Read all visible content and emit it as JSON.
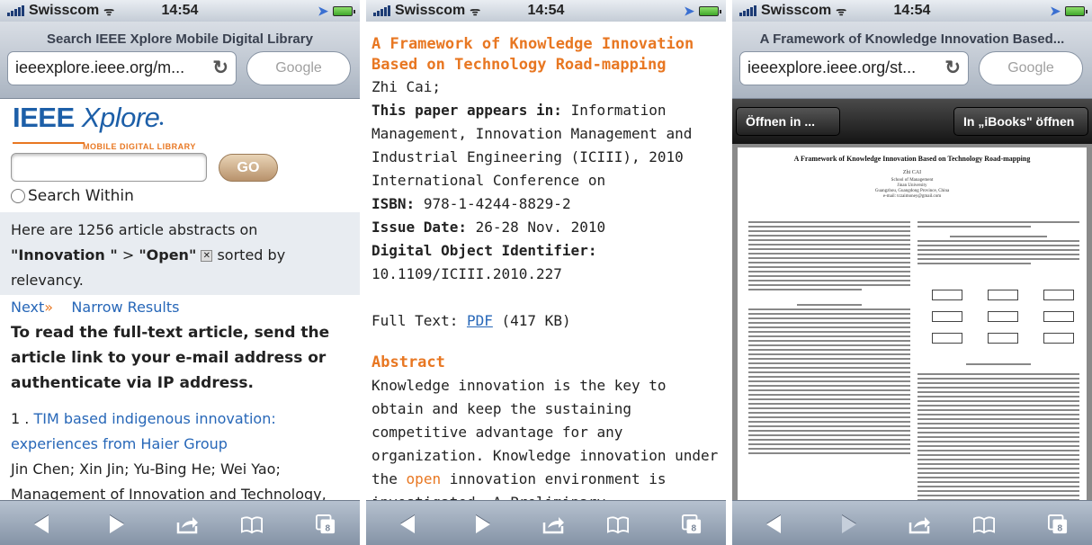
{
  "status_bar": {
    "carrier": "Swisscom",
    "time": "14:54"
  },
  "screens": [
    {
      "page_title": "Search IEEE Xplore Mobile Digital Library",
      "url": "ieeexplore.ieee.org/m...",
      "search_placeholder": "Google",
      "logo_text": "IEEE",
      "logo_text2": "Xplore",
      "logo_sub": "MOBILE DIGITAL LIBRARY",
      "go_label": "GO",
      "search_within": "Search Within",
      "info": {
        "prefix": "Here are 1256 article abstracts on",
        "term1": "\"Innovation \"",
        "sep": ">",
        "term2": "\"Open\"",
        "suffix": "sorted by relevancy."
      },
      "next_label": "Next",
      "narrow_label": "Narrow Results",
      "note": "To read the full-text article, send the article link to your e-mail address or authenticate via IP address.",
      "result": {
        "number": "1 .",
        "title": "TIM based indigenous innovation: experiences from Haier Group",
        "authors": "Jin Chen; Xin Jin; Yu-Bing He; Wei Yao;",
        "source": "Management of Innovation and Technology,"
      }
    },
    {
      "title": "A Framework of Knowledge Innovation Based on Technology Road-mapping",
      "author": "Zhi Cai;",
      "appears_label": "This paper appears in:",
      "appears_value": "Information Management, Innovation Management and Industrial Engineering (ICIII), 2010 International Conference on",
      "isbn_label": "ISBN:",
      "isbn_value": "978-1-4244-8829-2",
      "issue_label": "Issue Date:",
      "issue_value": "26-28 Nov. 2010",
      "doi_label": "Digital Object Identifier:",
      "doi_value": "10.1109/ICIII.2010.227",
      "fulltext_label": "Full Text:",
      "pdf_link": "PDF",
      "pdf_size": "(417 KB)",
      "abstract_heading": "Abstract",
      "abstract_a": "Knowledge innovation is the key to obtain and keep the sustaining competitive advantage for any organization. Knowledge innovation under the",
      "abstract_hl": "open",
      "abstract_b": "innovation environment is investigated. A Preliminary"
    },
    {
      "page_title": "A Framework of Knowledge Innovation Based...",
      "url": "ieeexplore.ieee.org/st...",
      "search_placeholder": "Google",
      "open_in": "Öffnen in ...",
      "open_ibooks": "In „iBooks\" öffnen",
      "pdf_title": "A Framework of Knowledge Innovation Based on Technology Road-mapping",
      "pdf_author": "Zhi CAI",
      "pdf_affil": "School of Management\nJinan University\nGuangzhou, Guangdong Province, China\ne-mail: tczaimoney@gmail.com"
    }
  ],
  "colors": {
    "accent_orange": "#e87722",
    "link_blue": "#2767b8",
    "ieee_blue": "#1d5fa8"
  }
}
